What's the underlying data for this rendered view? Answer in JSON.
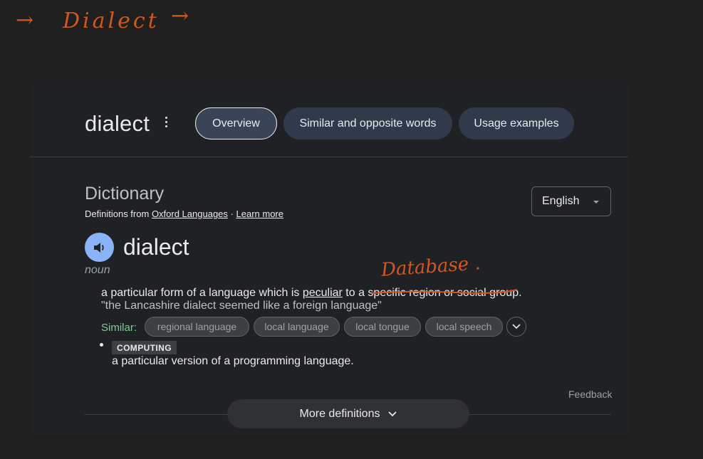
{
  "annotations": {
    "left_arrow": "→",
    "word": "Dialect",
    "right_arrow": "→",
    "database_note": "Database ."
  },
  "header": {
    "term": "dialect",
    "tabs": [
      {
        "label": "Overview",
        "active": true
      },
      {
        "label": "Similar and opposite words",
        "active": false
      },
      {
        "label": "Usage examples",
        "active": false
      }
    ]
  },
  "dictionary": {
    "title": "Dictionary",
    "source_prefix": "Definitions from",
    "source_link": "Oxford Languages",
    "separator": "·",
    "learn_more": "Learn more",
    "language": "English"
  },
  "entry": {
    "headword": "dialect",
    "part_of_speech": "noun",
    "definition_1": {
      "before": "a particular form of a language which is ",
      "underlined": "peculiar",
      "after": " to a specific region or social group."
    },
    "example_1": "\"the Lancashire dialect seemed like a foreign language\"",
    "similar_label": "Similar:",
    "similar_words": [
      "regional language",
      "local language",
      "local tongue",
      "local speech"
    ],
    "domain_label": "COMPUTING",
    "definition_2": "a particular version of a programming language."
  },
  "footer": {
    "feedback": "Feedback",
    "more_definitions": "More definitions"
  },
  "colors": {
    "background": "#1f1f1f",
    "panel": "#202124",
    "tab": "#303a4b",
    "accent_blue": "#8ab4f8",
    "similar_green": "#81c995",
    "ink": "#d2571c"
  }
}
